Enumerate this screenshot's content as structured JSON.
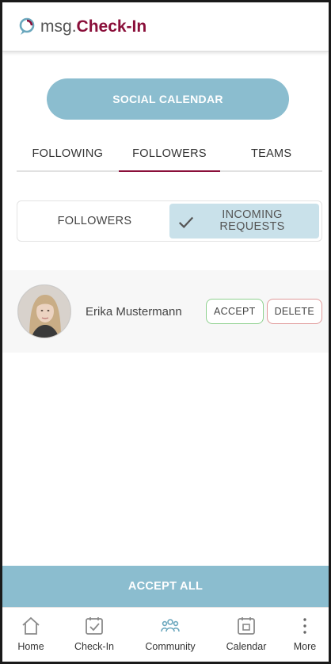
{
  "header": {
    "brand_prefix": "msg",
    "brand_dot": ".",
    "brand_name": "Check-In"
  },
  "social_calendar_label": "SOCIAL CALENDAR",
  "tabs": [
    {
      "label": "FOLLOWING",
      "active": false
    },
    {
      "label": "FOLLOWERS",
      "active": true
    },
    {
      "label": "TEAMS",
      "active": false
    }
  ],
  "segment": {
    "option_1": "FOLLOWERS",
    "option_2_line1": "INCOMING",
    "option_2_line2": "REQUESTS",
    "selected": "option_2"
  },
  "requests": [
    {
      "name": "Erika Mustermann",
      "accept_label": "ACCEPT",
      "delete_label": "DELETE"
    }
  ],
  "accept_all_label": "ACCEPT ALL",
  "bottom_nav": [
    {
      "label": "Home",
      "icon": "home-icon"
    },
    {
      "label": "Check-In",
      "icon": "checkin-icon"
    },
    {
      "label": "Community",
      "icon": "community-icon"
    },
    {
      "label": "Calendar",
      "icon": "calendar-icon"
    },
    {
      "label": "More",
      "icon": "more-icon"
    }
  ],
  "colors": {
    "brand": "#8a0f3a",
    "accent": "#8bbdcf",
    "segment_selected": "#c9e1ea",
    "accept_border": "#8fd18f",
    "delete_border": "#e09a9a"
  }
}
